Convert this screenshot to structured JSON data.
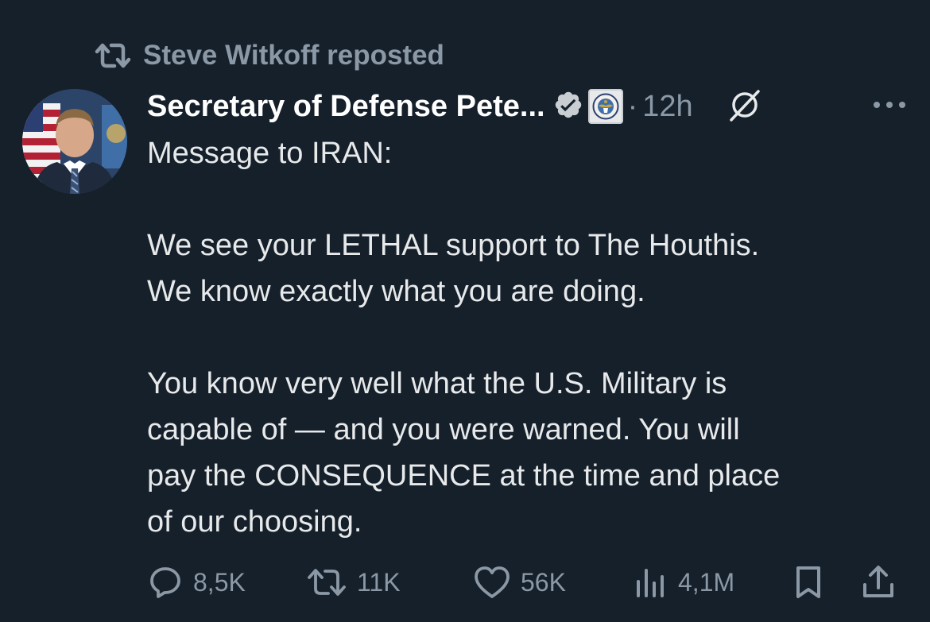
{
  "repost": {
    "icon": "repost-icon",
    "text": "Steve Witkoff reposted"
  },
  "author": {
    "name": "Secretary of Defense Pete...",
    "verified": true,
    "affiliation_badge": "department-of-defense-seal",
    "separator": "·",
    "timestamp": "12h"
  },
  "tweet": {
    "paragraphs": [
      [
        "Message to IRAN:"
      ],
      [
        "We see your LETHAL support to The Houthis.",
        "We know exactly what you are doing."
      ],
      [
        "You know very well what the U.S. Military is",
        "capable of — and you were warned. You will",
        "pay the CONSEQUENCE at the time and place",
        "of our choosing."
      ]
    ]
  },
  "actions": {
    "reply": {
      "icon": "reply-icon",
      "count": "8,5K"
    },
    "repost": {
      "icon": "repost-icon",
      "count": "11K"
    },
    "like": {
      "icon": "heart-icon",
      "count": "56K"
    },
    "views": {
      "icon": "views-chart-icon",
      "count": "4,1M"
    },
    "bookmark": {
      "icon": "bookmark-icon"
    },
    "share": {
      "icon": "share-icon"
    }
  },
  "colors": {
    "background": "#15202b",
    "primary_text": "#e7e9ea",
    "secondary_text": "#8b98a5",
    "verified_badge": "#c9ced3"
  }
}
